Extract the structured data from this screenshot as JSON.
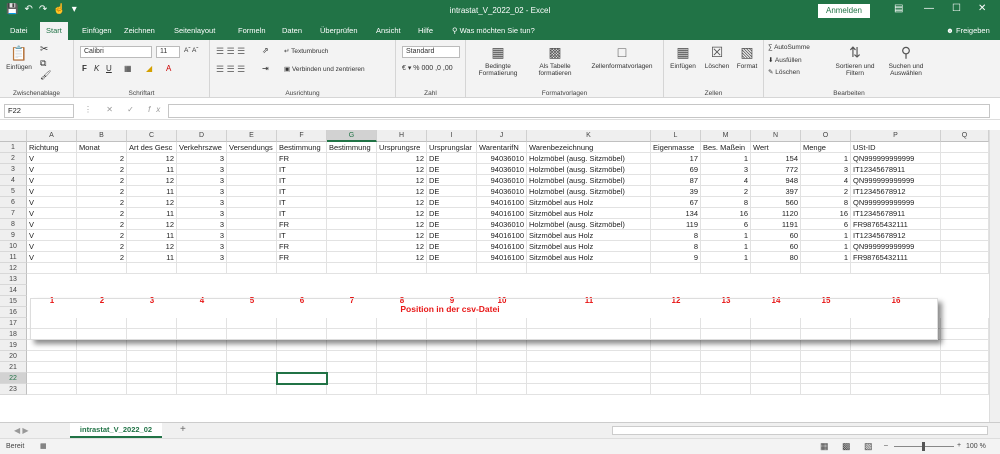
{
  "titlebar": {
    "title": "intrastat_V_2022_02  -  Excel",
    "signin": "Anmelden",
    "qa_icons": [
      "save-icon",
      "undo-icon",
      "redo-icon",
      "touch-icon",
      "customize-icon"
    ]
  },
  "menu": {
    "tabs": [
      "Datei",
      "Start",
      "Einfügen",
      "Zeichnen",
      "Seitenlayout",
      "Formeln",
      "Daten",
      "Überprüfen",
      "Ansicht",
      "Hilfe"
    ],
    "active": "Start",
    "search": "Was möchten Sie tun?",
    "share": "Freigeben"
  },
  "ribbon": {
    "clipboard": {
      "paste": "Einfügen",
      "label": "Zwischenablage"
    },
    "font": {
      "name": "Calibri",
      "size": "11",
      "label": "Schriftart"
    },
    "align": {
      "wrap": "Textumbruch",
      "merge": "Verbinden und zentrieren",
      "label": "Ausrichtung"
    },
    "number": {
      "format": "Standard",
      "label": "Zahl"
    },
    "styles": {
      "cond1": "Bedingte",
      "cond2": "Formatierung",
      "table1": "Als Tabelle",
      "table2": "formatieren",
      "cell": "Zellenformatvorlagen",
      "label": "Formatvorlagen"
    },
    "cells": {
      "insert": "Einfügen",
      "delete": "Löschen",
      "format": "Format",
      "label": "Zellen"
    },
    "edit": {
      "autosum": "AutoSumme",
      "fill": "Ausfüllen",
      "clear": "Löschen",
      "sort1": "Sortieren und",
      "sort2": "Filtern",
      "find1": "Suchen und",
      "find2": "Auswählen",
      "label": "Bearbeiten"
    }
  },
  "formula_bar": {
    "name_box": "F22",
    "formula": ""
  },
  "sheet": {
    "columns": [
      "A",
      "B",
      "C",
      "D",
      "E",
      "F",
      "G",
      "H",
      "I",
      "J",
      "K",
      "L",
      "M",
      "N",
      "O",
      "P",
      "Q"
    ],
    "selected_column": "G",
    "selected_cell": "F22",
    "selected_row": 22,
    "row_numbers": [
      1,
      2,
      3,
      4,
      5,
      6,
      7,
      8,
      9,
      10,
      11,
      12,
      13,
      14,
      15,
      16,
      17,
      18,
      19,
      20,
      21,
      22,
      23
    ],
    "headers": [
      "Richtung",
      "Monat",
      "Art des Gesc",
      "Verkehrszwe",
      "Versendungs",
      "Bestimmung",
      "Bestimmung",
      "Ursprungsre",
      "Ursprungslar",
      "WarentarifN",
      "Warenbezeichnung",
      "Eigenmasse",
      "Bes. Maßein",
      "Wert",
      "Menge",
      "USt-ID"
    ],
    "rows": [
      [
        "V",
        "2",
        "12",
        "3",
        "",
        "FR",
        "",
        "12",
        "DE",
        "94036010",
        "Holzmöbel (ausg. Sitzmöbel)",
        "17",
        "1",
        "154",
        "1",
        "QN999999999999"
      ],
      [
        "V",
        "2",
        "11",
        "3",
        "",
        "IT",
        "",
        "12",
        "DE",
        "94036010",
        "Holzmöbel (ausg. Sitzmöbel)",
        "69",
        "3",
        "772",
        "3",
        "IT12345678911"
      ],
      [
        "V",
        "2",
        "12",
        "3",
        "",
        "IT",
        "",
        "12",
        "DE",
        "94036010",
        "Holzmöbel (ausg. Sitzmöbel)",
        "87",
        "4",
        "948",
        "4",
        "QN999999999999"
      ],
      [
        "V",
        "2",
        "11",
        "3",
        "",
        "IT",
        "",
        "12",
        "DE",
        "94036010",
        "Holzmöbel (ausg. Sitzmöbel)",
        "39",
        "2",
        "397",
        "2",
        "IT12345678912"
      ],
      [
        "V",
        "2",
        "12",
        "3",
        "",
        "IT",
        "",
        "12",
        "DE",
        "94016100",
        "Sitzmöbel aus Holz",
        "67",
        "8",
        "560",
        "8",
        "QN999999999999"
      ],
      [
        "V",
        "2",
        "11",
        "3",
        "",
        "IT",
        "",
        "12",
        "DE",
        "94016100",
        "Sitzmöbel aus Holz",
        "134",
        "16",
        "1120",
        "16",
        "IT12345678911"
      ],
      [
        "V",
        "2",
        "12",
        "3",
        "",
        "FR",
        "",
        "12",
        "DE",
        "94036010",
        "Holzmöbel (ausg. Sitzmöbel)",
        "119",
        "6",
        "1191",
        "6",
        "FR98765432111"
      ],
      [
        "V",
        "2",
        "11",
        "3",
        "",
        "IT",
        "",
        "12",
        "DE",
        "94016100",
        "Sitzmöbel aus Holz",
        "8",
        "1",
        "60",
        "1",
        "IT12345678912"
      ],
      [
        "V",
        "2",
        "12",
        "3",
        "",
        "FR",
        "",
        "12",
        "DE",
        "94016100",
        "Sitzmöbel aus Holz",
        "8",
        "1",
        "60",
        "1",
        "QN999999999999"
      ],
      [
        "V",
        "2",
        "11",
        "3",
        "",
        "FR",
        "",
        "12",
        "DE",
        "94016100",
        "Sitzmöbel aus Holz",
        "9",
        "1",
        "80",
        "1",
        "FR98765432111"
      ]
    ],
    "numeric_columns": [
      1,
      2,
      3,
      7,
      9,
      11,
      12,
      13,
      14
    ]
  },
  "annotation": {
    "title": "Position in der csv-Datei",
    "numbers": [
      "1",
      "2",
      "3",
      "4",
      "5",
      "6",
      "7",
      "8",
      "9",
      "10",
      "11",
      "12",
      "13",
      "14",
      "15",
      "16"
    ],
    "color": "#e81616"
  },
  "sheet_tabs": {
    "active": "intrastat_V_2022_02",
    "add": "+"
  },
  "status": {
    "ready": "Bereit",
    "zoom": "100 %"
  },
  "colors": {
    "excel_green": "#217346",
    "annotation_red": "#e81616",
    "arrow": "#f5a623"
  }
}
